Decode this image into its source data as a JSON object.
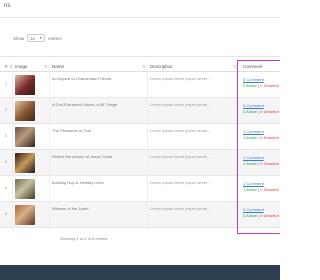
{
  "page": {
    "title": "ns"
  },
  "controls": {
    "show_label": "Show",
    "show_value": "10",
    "entries_label": "entries"
  },
  "table": {
    "headers": {
      "number": "#",
      "image": "Image",
      "name": "Name",
      "description": "Description",
      "comment": "Comment"
    },
    "rows": [
      {
        "number": "1",
        "name": "An Appeal to Charismatic Friends",
        "description": "Lorem ipsum lorem ipsum lorem ...",
        "comment_link": "0 Comment",
        "active": "0 Active",
        "inactive": "0 Deactive"
      },
      {
        "number": "2",
        "name": "A God Entranced Vision of All Things",
        "description": "Lorem ipsum lorem ipsum lorem ...",
        "comment_link": "0 Comment",
        "active": "0 Active",
        "inactive": "0 Deactive"
      },
      {
        "number": "3",
        "name": "The Pleasures of God",
        "description": "Lorem ipsum lorem ipsum lorem ...",
        "comment_link": "1 Comment",
        "active": "1 Active",
        "inactive": "0 Deactive"
      },
      {
        "number": "4",
        "name": "Reflect the person of Jesus Christ",
        "description": "Lorem ipsum lorem ipsum lorem ...",
        "comment_link": "1 Comment",
        "active": "1 Active",
        "inactive": "0 Deactive"
      },
      {
        "number": "5",
        "name": "Building Hop & Healthy Lives",
        "description": "Lorem ipsum lorem ipsum lorem ...",
        "comment_link": "1 Comment",
        "active": "1 Active",
        "inactive": "0 Deactive"
      },
      {
        "number": "6",
        "name": "Witness of the Lamb",
        "description": "Lorem ipsum lorem ipsum lorem ...",
        "comment_link": "0 Comment",
        "active": "0 Active",
        "inactive": "0 Deactive"
      }
    ]
  },
  "footer": {
    "info": "Showing 1 to 6 of 6 entries"
  },
  "colors": {
    "highlight": "#c23cbd",
    "footer_bar": "#2d3e50",
    "link": "#3a7ec8",
    "active": "#2e9b50",
    "inactive": "#dd4444"
  }
}
